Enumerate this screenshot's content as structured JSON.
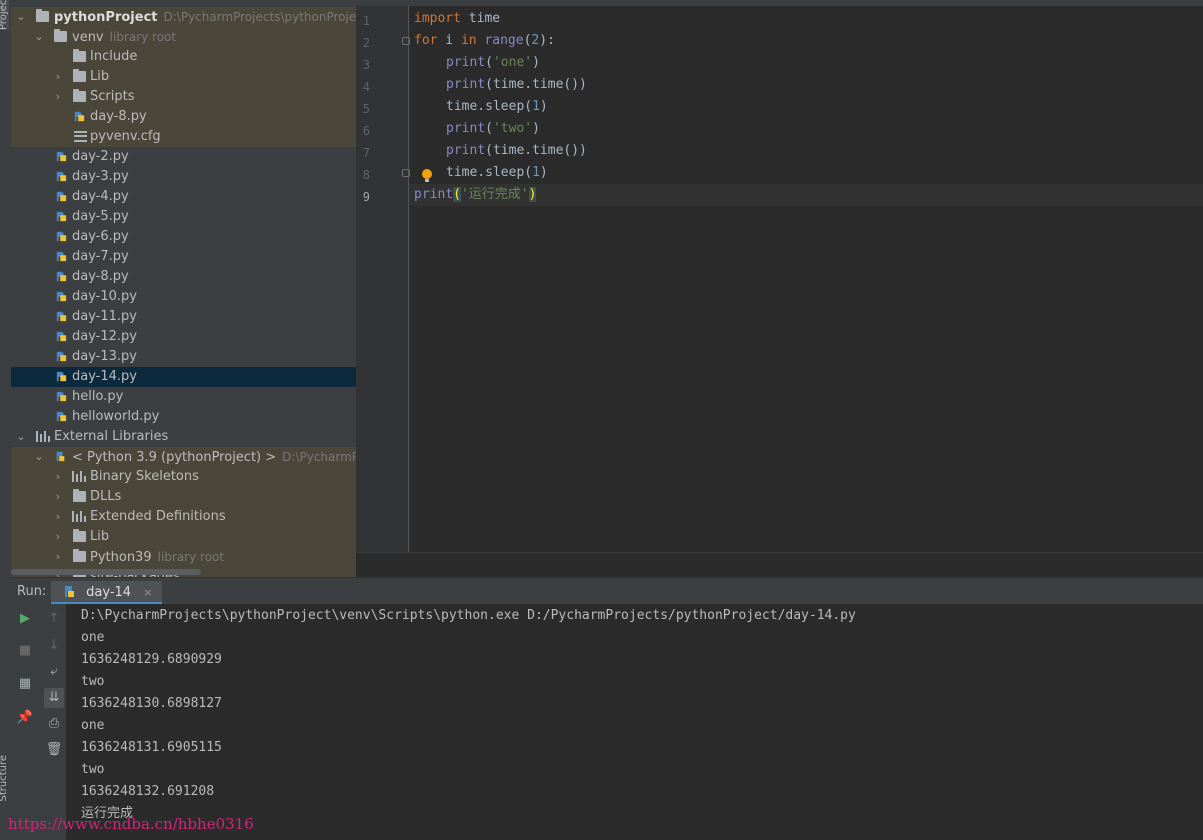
{
  "sidebar": {
    "project_label": "Project",
    "structure_label": "Structure"
  },
  "project_tree": {
    "root_name": "pythonProject",
    "root_path": "D:\\PycharmProjects\\pythonProject",
    "venv": {
      "name": "venv",
      "hint": "library root"
    },
    "venv_children": [
      "Include",
      "Lib",
      "Scripts",
      "day-8.py",
      "pyvenv.cfg"
    ],
    "files": [
      "day-2.py",
      "day-3.py",
      "day-4.py",
      "day-5.py",
      "day-6.py",
      "day-7.py",
      "day-8.py",
      "day-10.py",
      "day-11.py",
      "day-12.py",
      "day-13.py",
      "day-14.py",
      "hello.py",
      "helloworld.py"
    ],
    "selected_file": "day-14.py",
    "external_libraries": "External Libraries",
    "sdk": {
      "name": "< Python 3.9 (pythonProject) >",
      "path": "D:\\PycharmProjects\\pythonProject"
    },
    "sdk_children": [
      {
        "name": "Binary Skeletons",
        "icon": "library-icon"
      },
      {
        "name": "DLLs",
        "icon": "folder-icon"
      },
      {
        "name": "Extended Definitions",
        "icon": "library-icon"
      },
      {
        "name": "Lib",
        "icon": "folder-icon"
      },
      {
        "name": "Python39",
        "icon": "folder-icon",
        "hint": "library root"
      },
      {
        "name": "site-packages",
        "icon": "folder-icon"
      }
    ]
  },
  "editor": {
    "line_numbers": [
      "1",
      "2",
      "3",
      "4",
      "5",
      "6",
      "7",
      "8",
      "9"
    ],
    "code": [
      {
        "kw": "import",
        "rest": " time"
      },
      {
        "kw": "for",
        "rest": " i ",
        "kw2": "in",
        "fn": " range",
        "open": "(",
        "num": "2",
        "close": "):"
      },
      {
        "fn": "print",
        "open": "(",
        "str": "'one'",
        "close": ")"
      },
      {
        "fn": "print",
        "rest": "(time.time())"
      },
      {
        "rest": "time.sleep(",
        "num": "1",
        "close": ")"
      },
      {
        "fn": "print",
        "open": "(",
        "str": "'two'",
        "close": ")"
      },
      {
        "fn": "print",
        "rest": "(time.time())"
      },
      {
        "rest": "time.sleep(",
        "num": "1",
        "close": ")"
      },
      {
        "fn": "print",
        "open": "(",
        "str": "'运行完成'",
        "close": ")"
      }
    ]
  },
  "run_panel": {
    "label": "Run:",
    "tab_label": "day-14",
    "close_glyph": "×",
    "output": [
      "D:\\PycharmProjects\\pythonProject\\venv\\Scripts\\python.exe D:/PycharmProjects/pythonProject/day-14.py",
      "one",
      "1636248129.6890929",
      "two",
      "1636248130.6898127",
      "one",
      "1636248131.6905115",
      "two",
      "1636248132.691208",
      "运行完成"
    ]
  },
  "watermark": "https://www.cndba.cn/hbhe0316"
}
